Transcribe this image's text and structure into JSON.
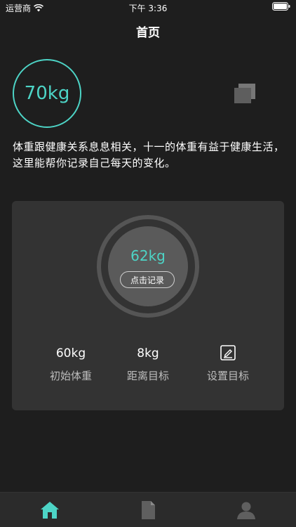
{
  "status_bar": {
    "carrier": "运营商",
    "time": "下午 3:36"
  },
  "nav": {
    "title": "首页"
  },
  "current": {
    "weight": "70kg"
  },
  "intro": "体重跟健康关系息息相关，十一的体重有益于健康生活，这里能帮你记录自己每天的变化。",
  "card": {
    "ring_weight": "62kg",
    "record_button": "点击记录",
    "stats": [
      {
        "value": "60kg",
        "label": "初始体重"
      },
      {
        "value": "8kg",
        "label": "距离目标"
      },
      {
        "value": "",
        "label": "设置目标"
      }
    ]
  },
  "tabs": [
    {
      "icon": "home-icon",
      "active": true
    },
    {
      "icon": "document-icon",
      "active": false
    },
    {
      "icon": "profile-icon",
      "active": false
    }
  ],
  "colors": {
    "accent": "#4dd4c6",
    "background": "#1e1e1e",
    "card": "#333333"
  }
}
